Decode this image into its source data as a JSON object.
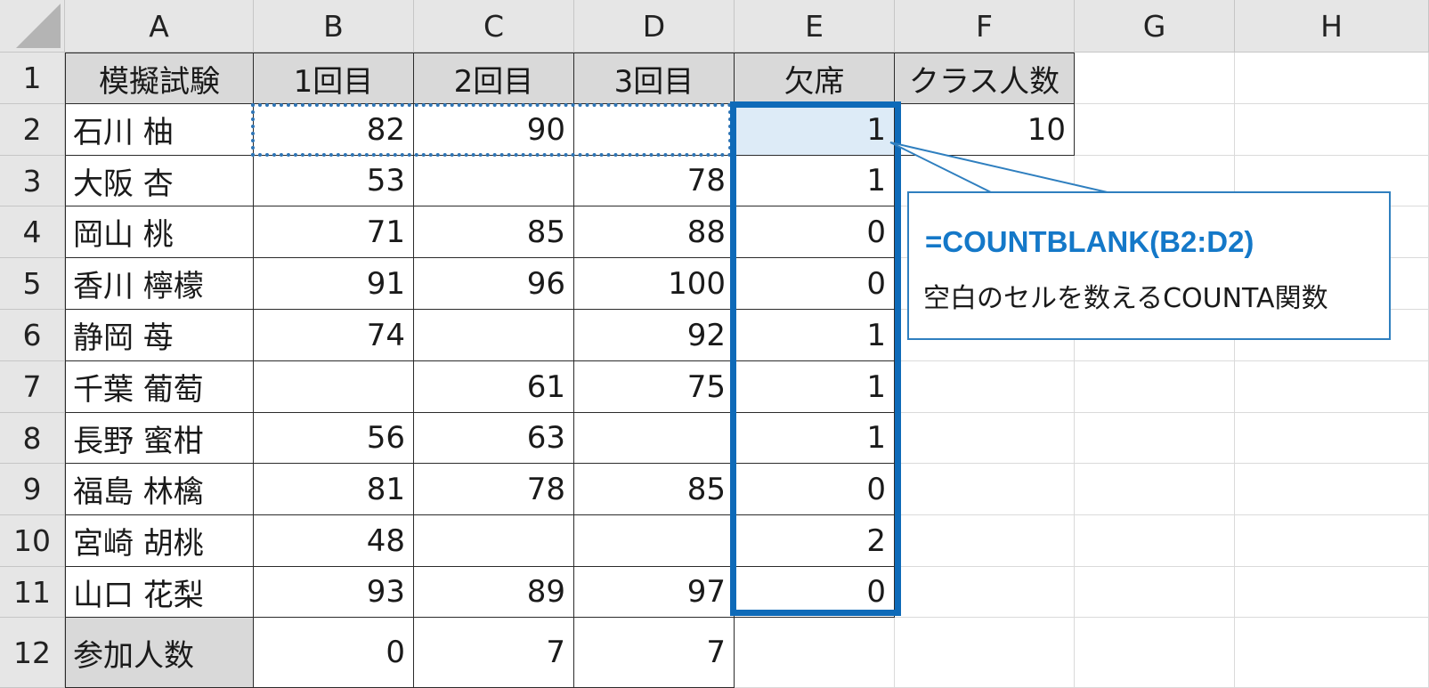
{
  "columns": [
    "A",
    "B",
    "C",
    "D",
    "E",
    "F",
    "G",
    "H"
  ],
  "rows": [
    "1",
    "2",
    "3",
    "4",
    "5",
    "6",
    "7",
    "8",
    "9",
    "10",
    "11",
    "12"
  ],
  "table": {
    "headers": [
      "模擬試験",
      "1回目",
      "2回目",
      "3回目",
      "欠席",
      "クラス人数"
    ],
    "records": [
      {
        "name": "石川 柚",
        "r1": "82",
        "r2": "90",
        "r3": "",
        "absent": "1",
        "class_size": "10"
      },
      {
        "name": "大阪 杏",
        "r1": "53",
        "r2": "",
        "r3": "78",
        "absent": "1"
      },
      {
        "name": "岡山 桃",
        "r1": "71",
        "r2": "85",
        "r3": "88",
        "absent": "0"
      },
      {
        "name": "香川 檸檬",
        "r1": "91",
        "r2": "96",
        "r3": "100",
        "absent": "0"
      },
      {
        "name": "静岡 苺",
        "r1": "74",
        "r2": "",
        "r3": "92",
        "absent": "1"
      },
      {
        "name": "千葉 葡萄",
        "r1": "",
        "r2": "61",
        "r3": "75",
        "absent": "1"
      },
      {
        "name": "長野 蜜柑",
        "r1": "56",
        "r2": "63",
        "r3": "",
        "absent": "1"
      },
      {
        "name": "福島 林檎",
        "r1": "81",
        "r2": "78",
        "r3": "85",
        "absent": "0"
      },
      {
        "name": "宮崎 胡桃",
        "r1": "48",
        "r2": "",
        "r3": "",
        "absent": "2"
      },
      {
        "name": "山口 花梨",
        "r1": "93",
        "r2": "89",
        "r3": "97",
        "absent": "0"
      }
    ],
    "footer": {
      "label": "参加人数",
      "r1": "0",
      "r2": "7",
      "r3": "7"
    }
  },
  "callout": {
    "formula": "=COUNTBLANK(B2:D2)",
    "description": "空白のセルを数えるCOUNTA関数"
  },
  "colors": {
    "accent": "#0e6ab8",
    "formula_text": "#1478c8",
    "header_fill": "#d9d9d9",
    "selected_cell": "#ddebf7"
  }
}
